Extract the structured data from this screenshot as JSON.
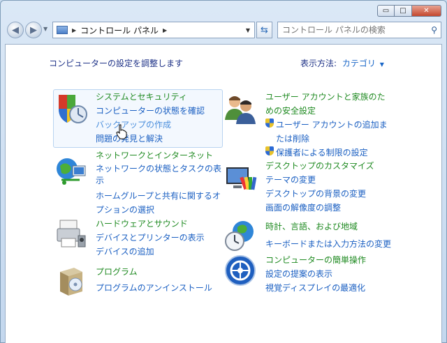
{
  "window": {
    "caption_buttons": {
      "minimize": "▭",
      "maximize": "□",
      "close": "✕"
    }
  },
  "nav": {
    "address_parts": [
      "コントロール パネル"
    ],
    "search_placeholder": "コントロール パネルの検索"
  },
  "page": {
    "heading": "コンピューターの設定を調整します",
    "view_by_label": "表示方法:",
    "view_by_value": "カテゴリ"
  },
  "categories": {
    "system": {
      "title": "システムとセキュリティ",
      "links": [
        "コンピューターの状態を確認",
        "バックアップの作成",
        "問題の発見と解決"
      ]
    },
    "network": {
      "title": "ネットワークとインターネット",
      "links": [
        "ネットワークの状態とタスクの表示",
        "ホームグループと共有に関するオプションの選択"
      ]
    },
    "hardware": {
      "title": "ハードウェアとサウンド",
      "links": [
        "デバイスとプリンターの表示",
        "デバイスの追加"
      ]
    },
    "programs": {
      "title": "プログラム",
      "links": [
        "プログラムのアンインストール"
      ]
    },
    "users": {
      "title_line1": "ユーザー アカウントと家族のた",
      "title_line2": "めの安全設定",
      "links": [
        "ユーザー アカウントの追加ま",
        "たは削除",
        "保護者による制限の設定"
      ]
    },
    "appearance": {
      "title": "デスクトップのカスタマイズ",
      "links": [
        "テーマの変更",
        "デスクトップの背景の変更",
        "画面の解像度の調整"
      ]
    },
    "clock": {
      "title": "時計、言語、および地域",
      "links": [
        "キーボードまたは入力方法の変更"
      ]
    },
    "ease": {
      "title": "コンピューターの簡単操作",
      "links": [
        "設定の提案の表示",
        "視覚ディスプレイの最適化"
      ]
    }
  }
}
